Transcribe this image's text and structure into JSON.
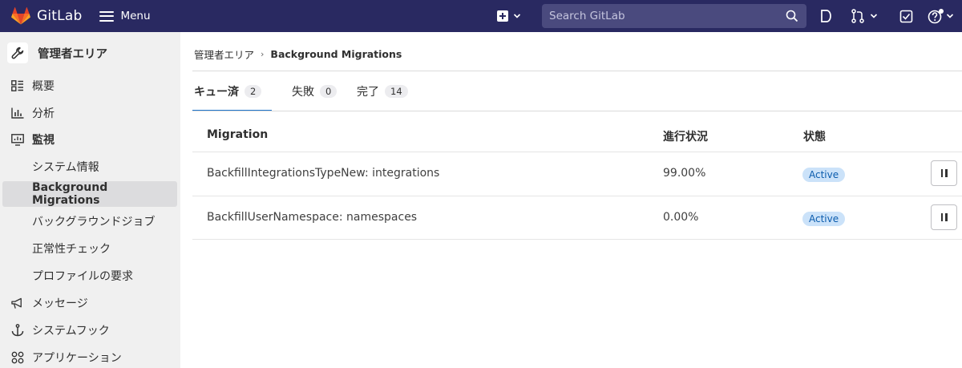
{
  "navbar": {
    "brand": "GitLab",
    "menu_label": "Menu",
    "search_placeholder": "Search GitLab"
  },
  "sidebar": {
    "title": "管理者エリア",
    "items": [
      {
        "label": "概要",
        "icon": "overview-icon"
      },
      {
        "label": "分析",
        "icon": "analytics-icon"
      },
      {
        "label": "監視",
        "icon": "monitor-icon"
      },
      {
        "label": "システム情報"
      },
      {
        "label": "Background Migrations"
      },
      {
        "label": "バックグラウンドジョブ"
      },
      {
        "label": "正常性チェック"
      },
      {
        "label": "プロファイルの要求"
      },
      {
        "label": "メッセージ",
        "icon": "bullhorn-icon"
      },
      {
        "label": "システムフック",
        "icon": "anchor-icon"
      },
      {
        "label": "アプリケーション",
        "icon": "applications-icon"
      }
    ]
  },
  "breadcrumb": {
    "parent": "管理者エリア",
    "current": "Background Migrations"
  },
  "tabs": [
    {
      "label": "キュー済",
      "count": "2"
    },
    {
      "label": "失敗",
      "count": "0"
    },
    {
      "label": "完了",
      "count": "14"
    }
  ],
  "table": {
    "headers": {
      "migration": "Migration",
      "progress": "進行状況",
      "status": "状態"
    },
    "rows": [
      {
        "migration": "BackfillIntegrationsTypeNew: integrations",
        "progress": "99.00%",
        "status": "Active"
      },
      {
        "migration": "BackfillUserNamespace: namespaces",
        "progress": "0.00%",
        "status": "Active"
      }
    ]
  },
  "colors": {
    "navbar": "#292961",
    "sidebar": "#f0f0f0",
    "tab_active": "#1f75cb",
    "badge_bg": "#cbe2f9",
    "badge_text": "#0b5cad"
  }
}
